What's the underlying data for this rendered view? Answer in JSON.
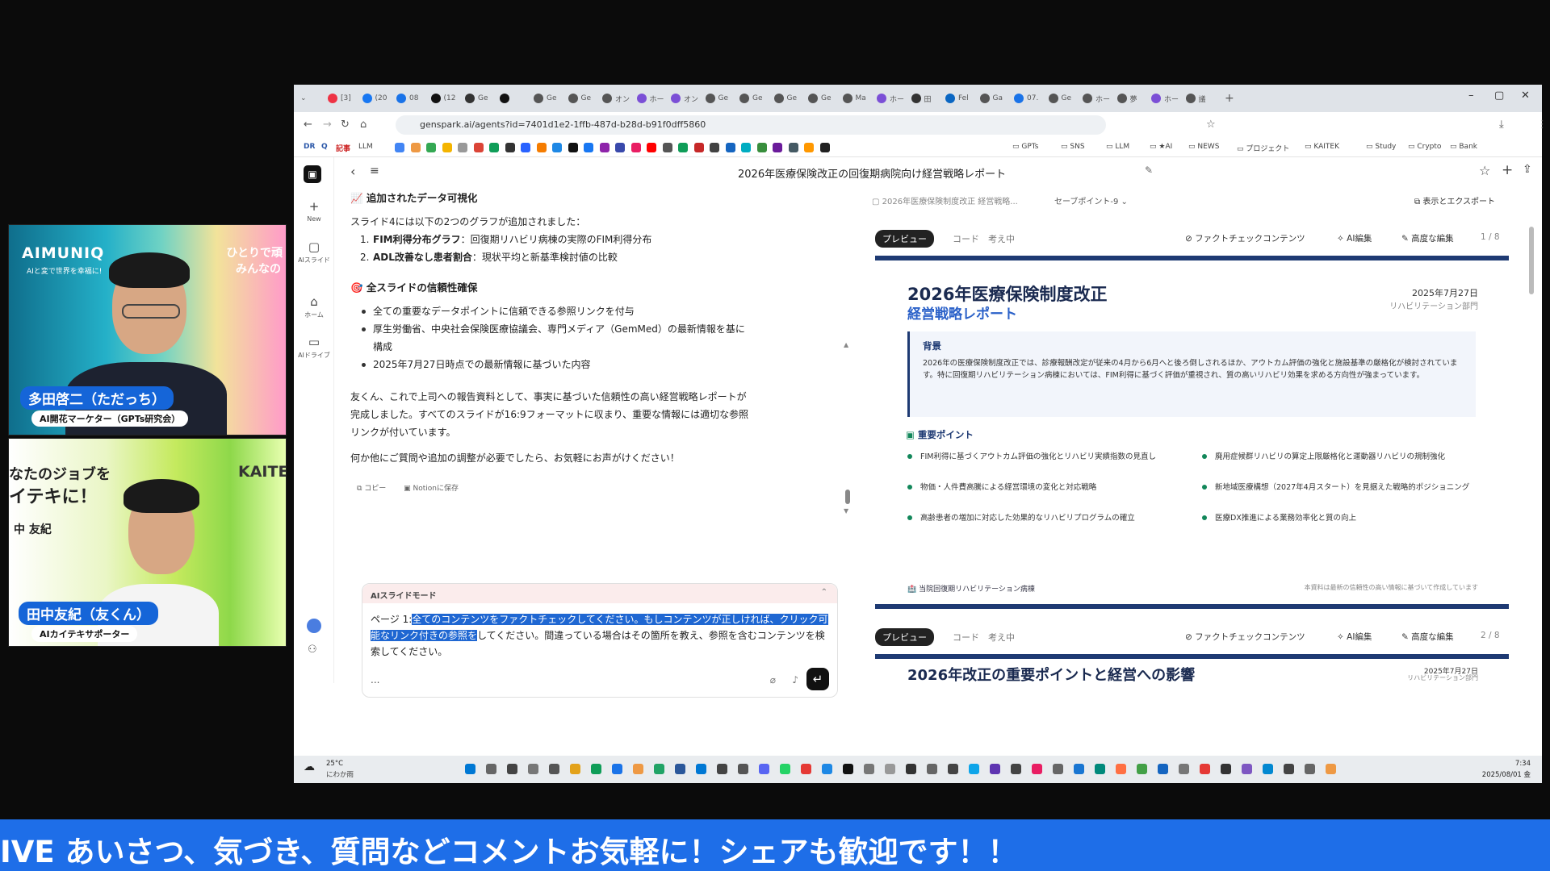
{
  "webcams": {
    "cam1": {
      "brand": "AIMUNIQ",
      "brand_sub": "AIと変で世界を幸福に!",
      "banner_right_1": "ひとりで頑",
      "banner_right_2": "みんなの",
      "name": "多田啓二（ただっち）",
      "role": "AI開花マーケター（GPTs研究会）"
    },
    "cam2": {
      "banner_left_1": "なたのジョブを",
      "banner_left_2": "イテキに！",
      "banner_left_3": "中 友紀",
      "banner_right": "KAITE",
      "name": "田中友紀（友くん）",
      "role": "AIカイテキサポーター"
    }
  },
  "browser": {
    "url": "genspark.ai/agents?id=7401d1e2-1ffb-487d-b28d-b91f0dff5860",
    "tabs": [
      "[3]",
      "(20",
      "08",
      "(12",
      "Ge",
      "",
      "Ge",
      "Ge",
      "オン",
      "ホー",
      "オン",
      "Ge",
      "Ge",
      "Ge",
      "Ge",
      "Ma",
      "ホー",
      "田",
      "Fel",
      "Ga",
      "07.",
      "Ge",
      "ホー",
      "夢",
      "ホー",
      "議"
    ],
    "bookmarks_text": [
      "DR",
      "Q",
      "記事",
      "LLM"
    ],
    "bookmark_folders": [
      "GPTs",
      "SNS",
      "LLM",
      "★AI",
      "NEWS",
      "プロジェクト",
      "KAITEK",
      "Study",
      "Crypto",
      "Bank"
    ]
  },
  "sidenav": {
    "items": [
      {
        "icon": "+",
        "label": "New"
      },
      {
        "icon": "▢",
        "label": "AIスライド"
      },
      {
        "icon": "⌂",
        "label": "ホーム"
      },
      {
        "icon": "▭",
        "label": "AIドライブ"
      }
    ]
  },
  "doc_title": "2026年医療保険改正の回復期病院向け経営戦略レポート",
  "chat": {
    "section1_title": "追加されたデータ可視化",
    "section1_intro": "スライド4には以下の2つのグラフが追加されました：",
    "section1_items": [
      {
        "num": "1.",
        "bold": "FIM利得分布グラフ",
        "rest": "：回復期リハビリ病棟の実際のFIM利得分布"
      },
      {
        "num": "2.",
        "bold": "ADL改善なし患者割合",
        "rest": "：現状平均と新基準検討値の比較"
      }
    ],
    "section2_title": "全スライドの信頼性確保",
    "section2_items": [
      "全ての重要なデータポイントに信頼できる参照リンクを付与",
      "厚生労働省、中央社会保険医療協議会、専門メディア（GemMed）の最新情報を基に構成",
      "2025年7月27日時点での最新情報に基づいた内容"
    ],
    "para1": "友くん、これで上司への報告資料として、事実に基づいた信頼性の高い経営戦略レポートが完成しました。すべてのスライドが16:9フォーマットに収まり、重要な情報には適切な参照リンクが付いています。",
    "para2": "何か他にご質問や追加の調整が必要でしたら、お気軽にお声がけください！",
    "copy_label": "コピー",
    "notion_label": "Notionに保存"
  },
  "composer": {
    "mode": "AIスライドモード",
    "prefix": "ページ 1:",
    "highlighted": "全てのコンテンツをファクトチェックしてください。もしコンテンツが正しければ、クリック可能なリンク付きの参照を",
    "rest": "してください。間違っている場合はその箇所を教え、参照を含むコンテンツを検索してください。",
    "more": "..."
  },
  "preview": {
    "breadcrumb": "2026年医療保険制度改正 経営戦略...",
    "savepoint": "セーブポイント-9",
    "export": "表示とエクスポート",
    "tab_preview": "プレビュー",
    "tab_code": "コード",
    "tab_thinking": "考え中",
    "act_factcheck": "ファクトチェックコンテンツ",
    "act_ai_edit": "AI編集",
    "act_adv_edit": "高度な編集",
    "slide1": {
      "page": "1 / 8",
      "title": "2026年医療保険制度改正",
      "subtitle": "経営戦略レポート",
      "date": "2025年7月27日",
      "dept": "リハビリテーション部門",
      "bg_title": "背景",
      "bg_text": "2026年の医療保険制度改正では、診療報酬改定が従来の4月から6月へと後ろ倒しされるほか、アウトカム評価の強化と施設基準の厳格化が検討されています。特に回復期リハビリテーション病棟においては、FIM利得に基づく評価が重視され、質の高いリハビリ効果を求める方向性が強まっています。",
      "points_title": "重要ポイント",
      "points": [
        "FIM利得に基づくアウトカム評価の強化とリハビリ実績指数の見直し",
        "廃用症候群リハビリの算定上限厳格化と運動器リハビリの規制強化",
        "物価・人件費高騰による経営環境の変化と対応戦略",
        "新地域医療構想（2027年4月スタート）を見据えた戦略的ポジショニング",
        "高齢患者の増加に対応した効果的なリハビリプログラムの確立",
        "医療DX推進による業務効率化と質の向上"
      ],
      "footer_left": "当院回復期リハビリテーション病棟",
      "footer_right": "本資料は最新の信頼性の高い情報に基づいて作成しています"
    },
    "slide2": {
      "page": "2 / 8",
      "title": "2026年改正の重要ポイントと経営への影響",
      "date": "2025年7月27日",
      "dept": "リハビリテーション部門"
    }
  },
  "taskbar": {
    "weather_temp": "25°C",
    "weather_text": "にわか雨",
    "time": "7:34",
    "date": "2025/08/01 金"
  },
  "ticker": "IVE あいさつ、気づき、質問などコメントお気軽に！シェアも歓迎です！！"
}
